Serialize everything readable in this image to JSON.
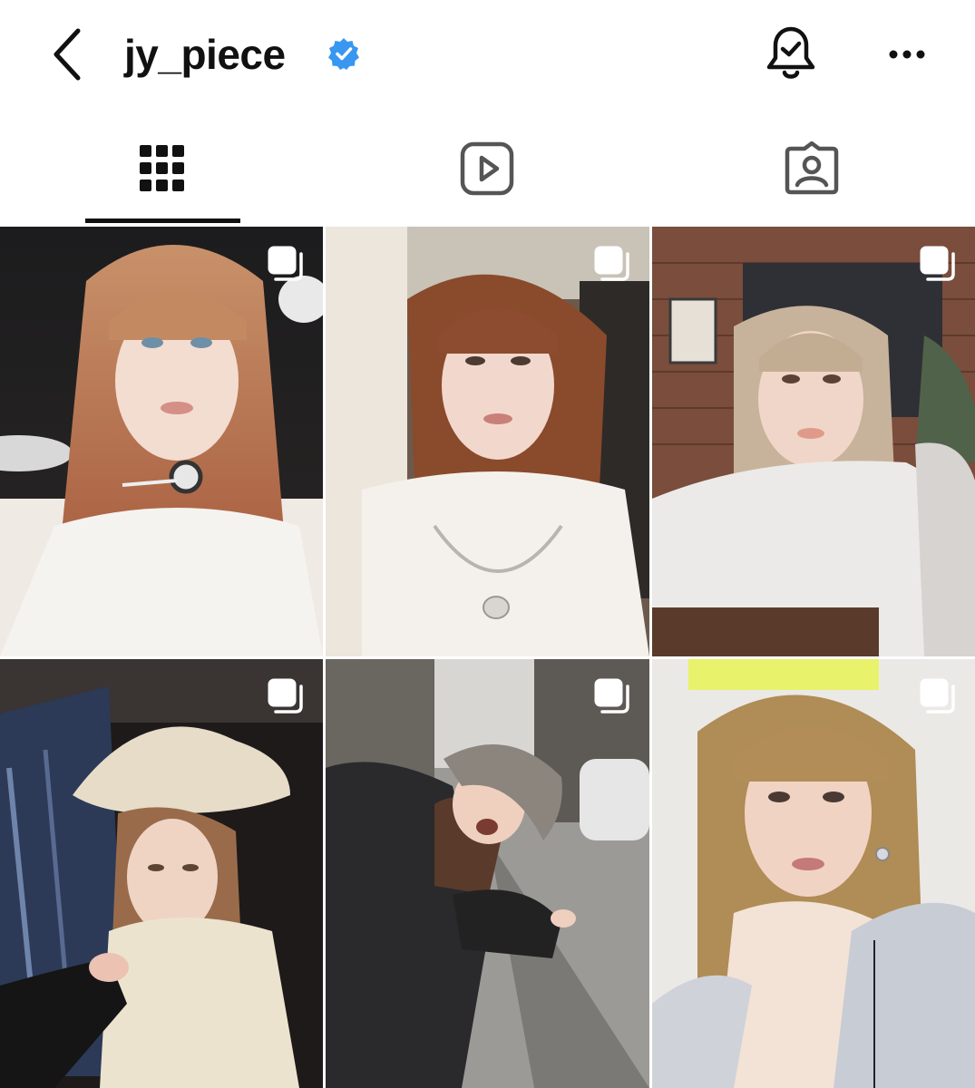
{
  "header": {
    "username": "jy_piece",
    "verified": true,
    "icons": [
      "back-chevron-icon",
      "verified-badge-icon",
      "notification-bell-icon",
      "more-options-icon"
    ]
  },
  "tabs": [
    {
      "id": "posts",
      "icon": "grid-icon",
      "selected": true
    },
    {
      "id": "reels",
      "icon": "reels-icon",
      "selected": false
    },
    {
      "id": "tagged",
      "icon": "tagged-icon",
      "selected": false
    }
  ],
  "posts": [
    {
      "index": 1,
      "multi_photo": true,
      "icon": "carousel-icon"
    },
    {
      "index": 2,
      "multi_photo": true,
      "icon": "carousel-icon"
    },
    {
      "index": 3,
      "multi_photo": true,
      "icon": "carousel-icon"
    },
    {
      "index": 4,
      "multi_photo": true,
      "icon": "carousel-icon"
    },
    {
      "index": 5,
      "multi_photo": true,
      "icon": "carousel-icon"
    },
    {
      "index": 6,
      "multi_photo": true,
      "icon": "carousel-icon"
    }
  ],
  "colors": {
    "accent": "#3897f0",
    "text": "#111111"
  }
}
